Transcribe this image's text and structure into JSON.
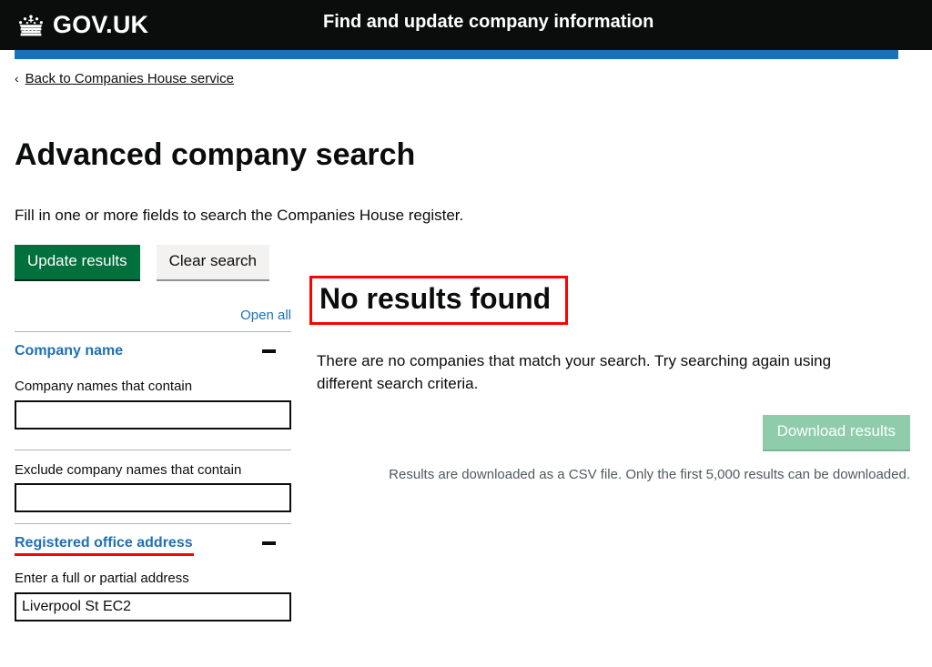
{
  "header": {
    "brand": "GOV.UK",
    "crown_icon": "crown-icon",
    "service_name": "Find and update company information",
    "accent_blue": "#1d70b8",
    "background": "#0b0c0c"
  },
  "back_link": {
    "chevron": "‹",
    "label": "Back to Companies House service"
  },
  "page": {
    "title": "Advanced company search",
    "intro": "Fill in one or more fields to search the Companies House register."
  },
  "toolbar": {
    "update_label": "Update results",
    "clear_label": "Clear search",
    "primary_color": "#00703c",
    "secondary_color": "#f3f2f1"
  },
  "accordion": {
    "open_all_label": "Open all",
    "toggle_icon": "minus-icon",
    "sections": [
      {
        "title": "Company name",
        "expanded": true,
        "highlighted": false,
        "fields": [
          {
            "label": "Company names that contain",
            "value": "",
            "placeholder": ""
          },
          {
            "label": "Exclude company names that contain",
            "value": "",
            "placeholder": ""
          }
        ]
      },
      {
        "title": "Registered office address",
        "expanded": true,
        "highlighted": true,
        "highlight_color": "#ff0000",
        "fields": [
          {
            "label": "Enter a full or partial address",
            "value": "Liverpool St EC2",
            "placeholder": ""
          }
        ]
      }
    ]
  },
  "results": {
    "heading": "No results found",
    "heading_highlight_color": "#ff0000",
    "body": "There are no companies that match your search. Try searching again using different search criteria.",
    "download_label": "Download results",
    "download_disabled": true,
    "download_note": "Results are downloaded as a CSV file. Only the first 5,000 results can be downloaded."
  }
}
